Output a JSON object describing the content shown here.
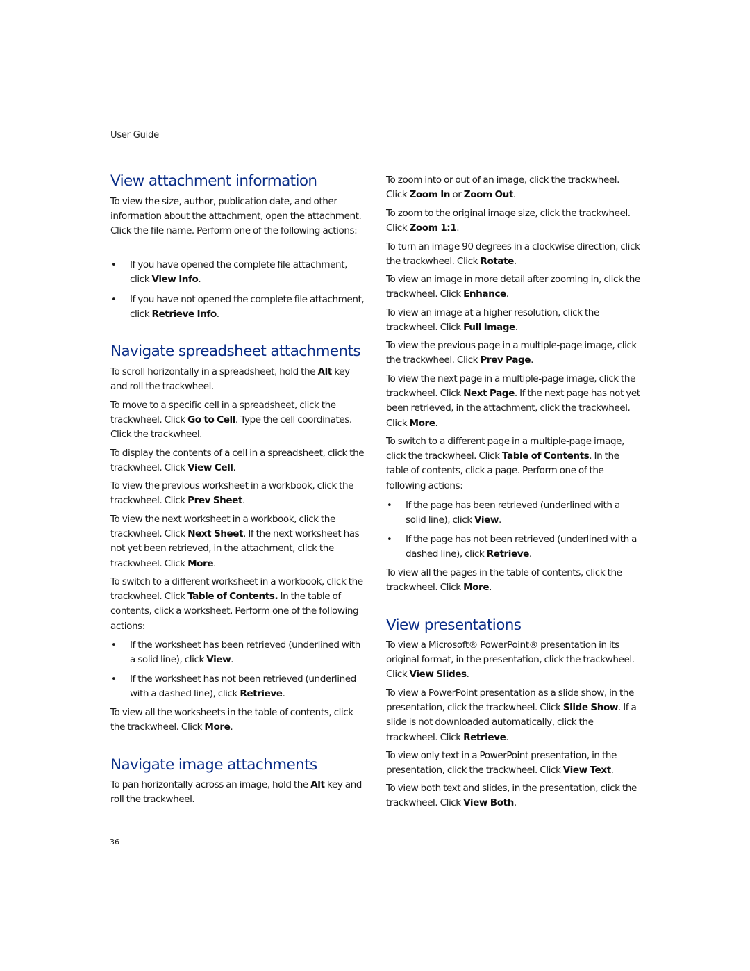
{
  "header": {
    "running_title": "User Guide"
  },
  "footer": {
    "page_number": "36"
  },
  "colors": {
    "heading": "#0a2d87",
    "body_text": "#1a1a1a"
  },
  "left_column": {
    "view_attachment_info": {
      "heading": "View attachment information",
      "intro": "To view the size, author, publication date, and other information about the attachment, open the attachment. Click the file name. Perform one of the following actions:",
      "bullets": [
        {
          "pre": "If you have opened the complete file attachment, click ",
          "bold": "View Info",
          "post": "."
        },
        {
          "pre": "If you have not opened the complete file attachment, click ",
          "bold": "Retrieve Info",
          "post": "."
        }
      ]
    },
    "navigate_spreadsheet": {
      "heading": "Navigate spreadsheet attachments",
      "p1": {
        "pre": "To scroll horizontally in a spreadsheet, hold the ",
        "bold": "Alt",
        "post": " key and roll the trackwheel."
      },
      "p2": {
        "pre": "To move to a specific cell in a spreadsheet, click the trackwheel. Click ",
        "bold": "Go to Cell",
        "post": ". Type the cell coordinates. Click the trackwheel."
      },
      "p3": {
        "pre": "To display the contents of a cell in a spreadsheet, click the trackwheel. Click ",
        "bold": "View Cell",
        "post": "."
      },
      "p4": {
        "pre": "To view the previous worksheet in a workbook, click the trackwheel. Click ",
        "bold": "Prev Sheet",
        "post": "."
      },
      "p5": {
        "pre": "To view the next worksheet in a workbook, click the trackwheel. Click ",
        "bold": "Next Sheet",
        "mid": ". If the next worksheet has not yet been retrieved, in the attachment, click the trackwheel. Click ",
        "bold2": "More",
        "post": "."
      },
      "p6": {
        "pre": "To switch to a different worksheet in a workbook, click the trackwheel. Click ",
        "bold": "Table of Contents.",
        "post": " In the table of contents, click a worksheet. Perform one of the following actions:"
      },
      "bullets": [
        {
          "pre": "If the worksheet has been retrieved (underlined with a solid line), click ",
          "bold": "View",
          "post": "."
        },
        {
          "pre": "If the worksheet has not been retrieved (underlined with a dashed line), click ",
          "bold": "Retrieve",
          "post": "."
        }
      ],
      "p7": {
        "pre": "To view all the worksheets in the table of contents, click the trackwheel. Click ",
        "bold": "More",
        "post": "."
      }
    },
    "navigate_image": {
      "heading": "Navigate image attachments",
      "p1": {
        "pre": "To pan horizontally across an image, hold the ",
        "bold": "Alt",
        "post": " key and roll the trackwheel."
      }
    }
  },
  "right_column": {
    "image_paragraphs": [
      {
        "pre": "To zoom into or out of an image, click the trackwheel. Click ",
        "bold": "Zoom In",
        "mid": " or ",
        "bold2": "Zoom Out",
        "post": "."
      },
      {
        "pre": "To zoom to the original image size, click the trackwheel. Click ",
        "bold": "Zoom 1:1",
        "post": "."
      },
      {
        "pre": "To turn an image 90 degrees in a clockwise direction, click the trackwheel. Click ",
        "bold": "Rotate",
        "post": "."
      },
      {
        "pre": "To view an image in more detail after zooming in, click the trackwheel. Click ",
        "bold": "Enhance",
        "post": "."
      },
      {
        "pre": "To view an image at a higher resolution, click the trackwheel. Click ",
        "bold": "Full Image",
        "post": "."
      },
      {
        "pre": "To view the previous page in a multiple-page image, click the trackwheel. Click ",
        "bold": "Prev Page",
        "post": "."
      },
      {
        "pre": "To view the next page in a multiple-page image, click the trackwheel. Click ",
        "bold": "Next Page",
        "mid": ". If the next page has not yet been retrieved, in the attachment, click the trackwheel. Click ",
        "bold2": "More",
        "post": "."
      },
      {
        "pre": "To switch to a different page in a multiple-page image, click the trackwheel. Click ",
        "bold": "Table of Contents",
        "post": ". In the table of contents, click a page. Perform one of the following actions:"
      }
    ],
    "image_bullets": [
      {
        "pre": "If the page has been retrieved (underlined with a solid line), click ",
        "bold": "View",
        "post": "."
      },
      {
        "pre": "If the page has not been retrieved (underlined with a dashed line), click ",
        "bold": "Retrieve",
        "post": "."
      }
    ],
    "image_after": {
      "pre": "To view all the pages in the table of contents, click the trackwheel. Click ",
      "bold": "More",
      "post": "."
    },
    "view_presentations": {
      "heading": "View presentations",
      "p1": {
        "pre": "To view a Microsoft® PowerPoint® presentation in its original format, in the presentation, click the trackwheel. Click ",
        "bold": "View Slides",
        "post": "."
      },
      "p2": {
        "pre": "To view a PowerPoint presentation as a slide show, in the presentation, click the trackwheel. Click ",
        "bold": "Slide Show",
        "post": ". If a slide is not downloaded automatically, click the trackwheel. Click ",
        "bold2": "Retrieve",
        "post2": "."
      },
      "p3": {
        "pre": "To view only text in a PowerPoint presentation, in the presentation, click the trackwheel. Click ",
        "bold": "View Text",
        "post": "."
      },
      "p4": {
        "pre": "To view both text and slides, in the presentation, click the trackwheel. Click ",
        "bold": "View Both",
        "post": "."
      }
    }
  }
}
